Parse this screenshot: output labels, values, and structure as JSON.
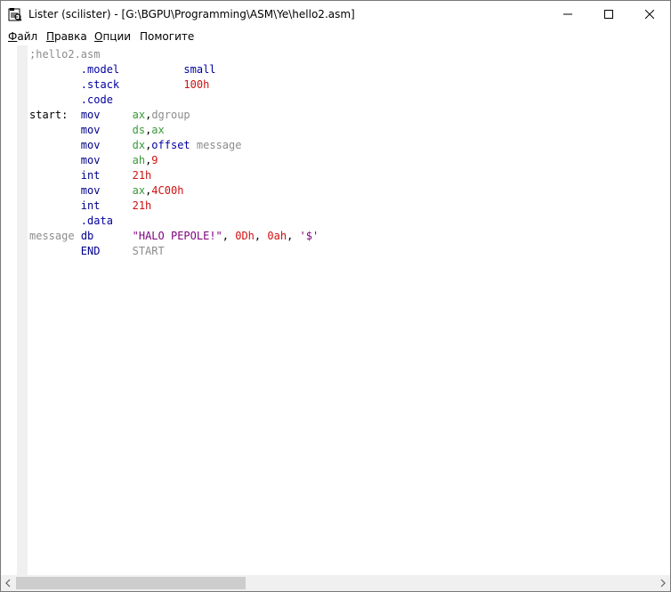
{
  "window": {
    "title": "Lister (scilister) - [G:\\BGPU\\Programming\\ASM\\Ye\\hello2.asm]",
    "app_icon": "lister-icon"
  },
  "menu": {
    "items": [
      {
        "accel": "Ф",
        "rest": "айл"
      },
      {
        "accel": "П",
        "rest": "равка"
      },
      {
        "accel": "О",
        "rest": "пции"
      },
      {
        "accel": "",
        "rest": "Помогите"
      }
    ]
  },
  "code": {
    "lines": [
      [
        {
          "t": ";hello2.asm",
          "c": "comment"
        }
      ],
      [
        {
          "t": "        ",
          "c": "plain"
        },
        {
          "t": ".model",
          "c": "directive"
        },
        {
          "t": "          ",
          "c": "plain"
        },
        {
          "t": "small",
          "c": "directive"
        }
      ],
      [
        {
          "t": "        ",
          "c": "plain"
        },
        {
          "t": ".stack",
          "c": "directive"
        },
        {
          "t": "          ",
          "c": "plain"
        },
        {
          "t": "100h",
          "c": "num"
        }
      ],
      [
        {
          "t": "        ",
          "c": "plain"
        },
        {
          "t": ".code",
          "c": "directive"
        }
      ],
      [
        {
          "t": "start:",
          "c": "label"
        },
        {
          "t": "  ",
          "c": "plain"
        },
        {
          "t": "mov",
          "c": "instr"
        },
        {
          "t": "     ",
          "c": "plain"
        },
        {
          "t": "ax",
          "c": "reg"
        },
        {
          "t": ",",
          "c": "plain"
        },
        {
          "t": "dgroup",
          "c": "ident"
        }
      ],
      [
        {
          "t": "        ",
          "c": "plain"
        },
        {
          "t": "mov",
          "c": "instr"
        },
        {
          "t": "     ",
          "c": "plain"
        },
        {
          "t": "ds",
          "c": "reg"
        },
        {
          "t": ",",
          "c": "plain"
        },
        {
          "t": "ax",
          "c": "reg"
        }
      ],
      [
        {
          "t": "        ",
          "c": "plain"
        },
        {
          "t": "mov",
          "c": "instr"
        },
        {
          "t": "     ",
          "c": "plain"
        },
        {
          "t": "dx",
          "c": "reg"
        },
        {
          "t": ",",
          "c": "plain"
        },
        {
          "t": "offset",
          "c": "op"
        },
        {
          "t": " ",
          "c": "plain"
        },
        {
          "t": "message",
          "c": "ident"
        }
      ],
      [
        {
          "t": "        ",
          "c": "plain"
        },
        {
          "t": "mov",
          "c": "instr"
        },
        {
          "t": "     ",
          "c": "plain"
        },
        {
          "t": "ah",
          "c": "reg"
        },
        {
          "t": ",",
          "c": "plain"
        },
        {
          "t": "9",
          "c": "num"
        }
      ],
      [
        {
          "t": "        ",
          "c": "plain"
        },
        {
          "t": "int",
          "c": "instr"
        },
        {
          "t": "     ",
          "c": "plain"
        },
        {
          "t": "21h",
          "c": "num"
        }
      ],
      [
        {
          "t": "        ",
          "c": "plain"
        },
        {
          "t": "mov",
          "c": "instr"
        },
        {
          "t": "     ",
          "c": "plain"
        },
        {
          "t": "ax",
          "c": "reg"
        },
        {
          "t": ",",
          "c": "plain"
        },
        {
          "t": "4C00h",
          "c": "num"
        }
      ],
      [
        {
          "t": "        ",
          "c": "plain"
        },
        {
          "t": "int",
          "c": "instr"
        },
        {
          "t": "     ",
          "c": "plain"
        },
        {
          "t": "21h",
          "c": "num"
        }
      ],
      [
        {
          "t": "        ",
          "c": "plain"
        },
        {
          "t": ".data",
          "c": "directive"
        }
      ],
      [
        {
          "t": "message",
          "c": "ident"
        },
        {
          "t": " ",
          "c": "plain"
        },
        {
          "t": "db",
          "c": "instr"
        },
        {
          "t": "      ",
          "c": "plain"
        },
        {
          "t": "\"HALO PEPOLE!\"",
          "c": "str"
        },
        {
          "t": ", ",
          "c": "plain"
        },
        {
          "t": "0Dh",
          "c": "num"
        },
        {
          "t": ", ",
          "c": "plain"
        },
        {
          "t": "0ah",
          "c": "num"
        },
        {
          "t": ", ",
          "c": "plain"
        },
        {
          "t": "'$'",
          "c": "str"
        }
      ],
      [
        {
          "t": "        ",
          "c": "plain"
        },
        {
          "t": "END",
          "c": "instr"
        },
        {
          "t": "     ",
          "c": "plain"
        },
        {
          "t": "START",
          "c": "kw"
        }
      ]
    ]
  },
  "colors": {
    "comment": "#8c8c8c",
    "directive": "#0000a0",
    "register": "#3a9a3a",
    "number": "#d01010",
    "string": "#7d007d"
  },
  "scrollbar": {
    "horizontal_position": 0
  }
}
